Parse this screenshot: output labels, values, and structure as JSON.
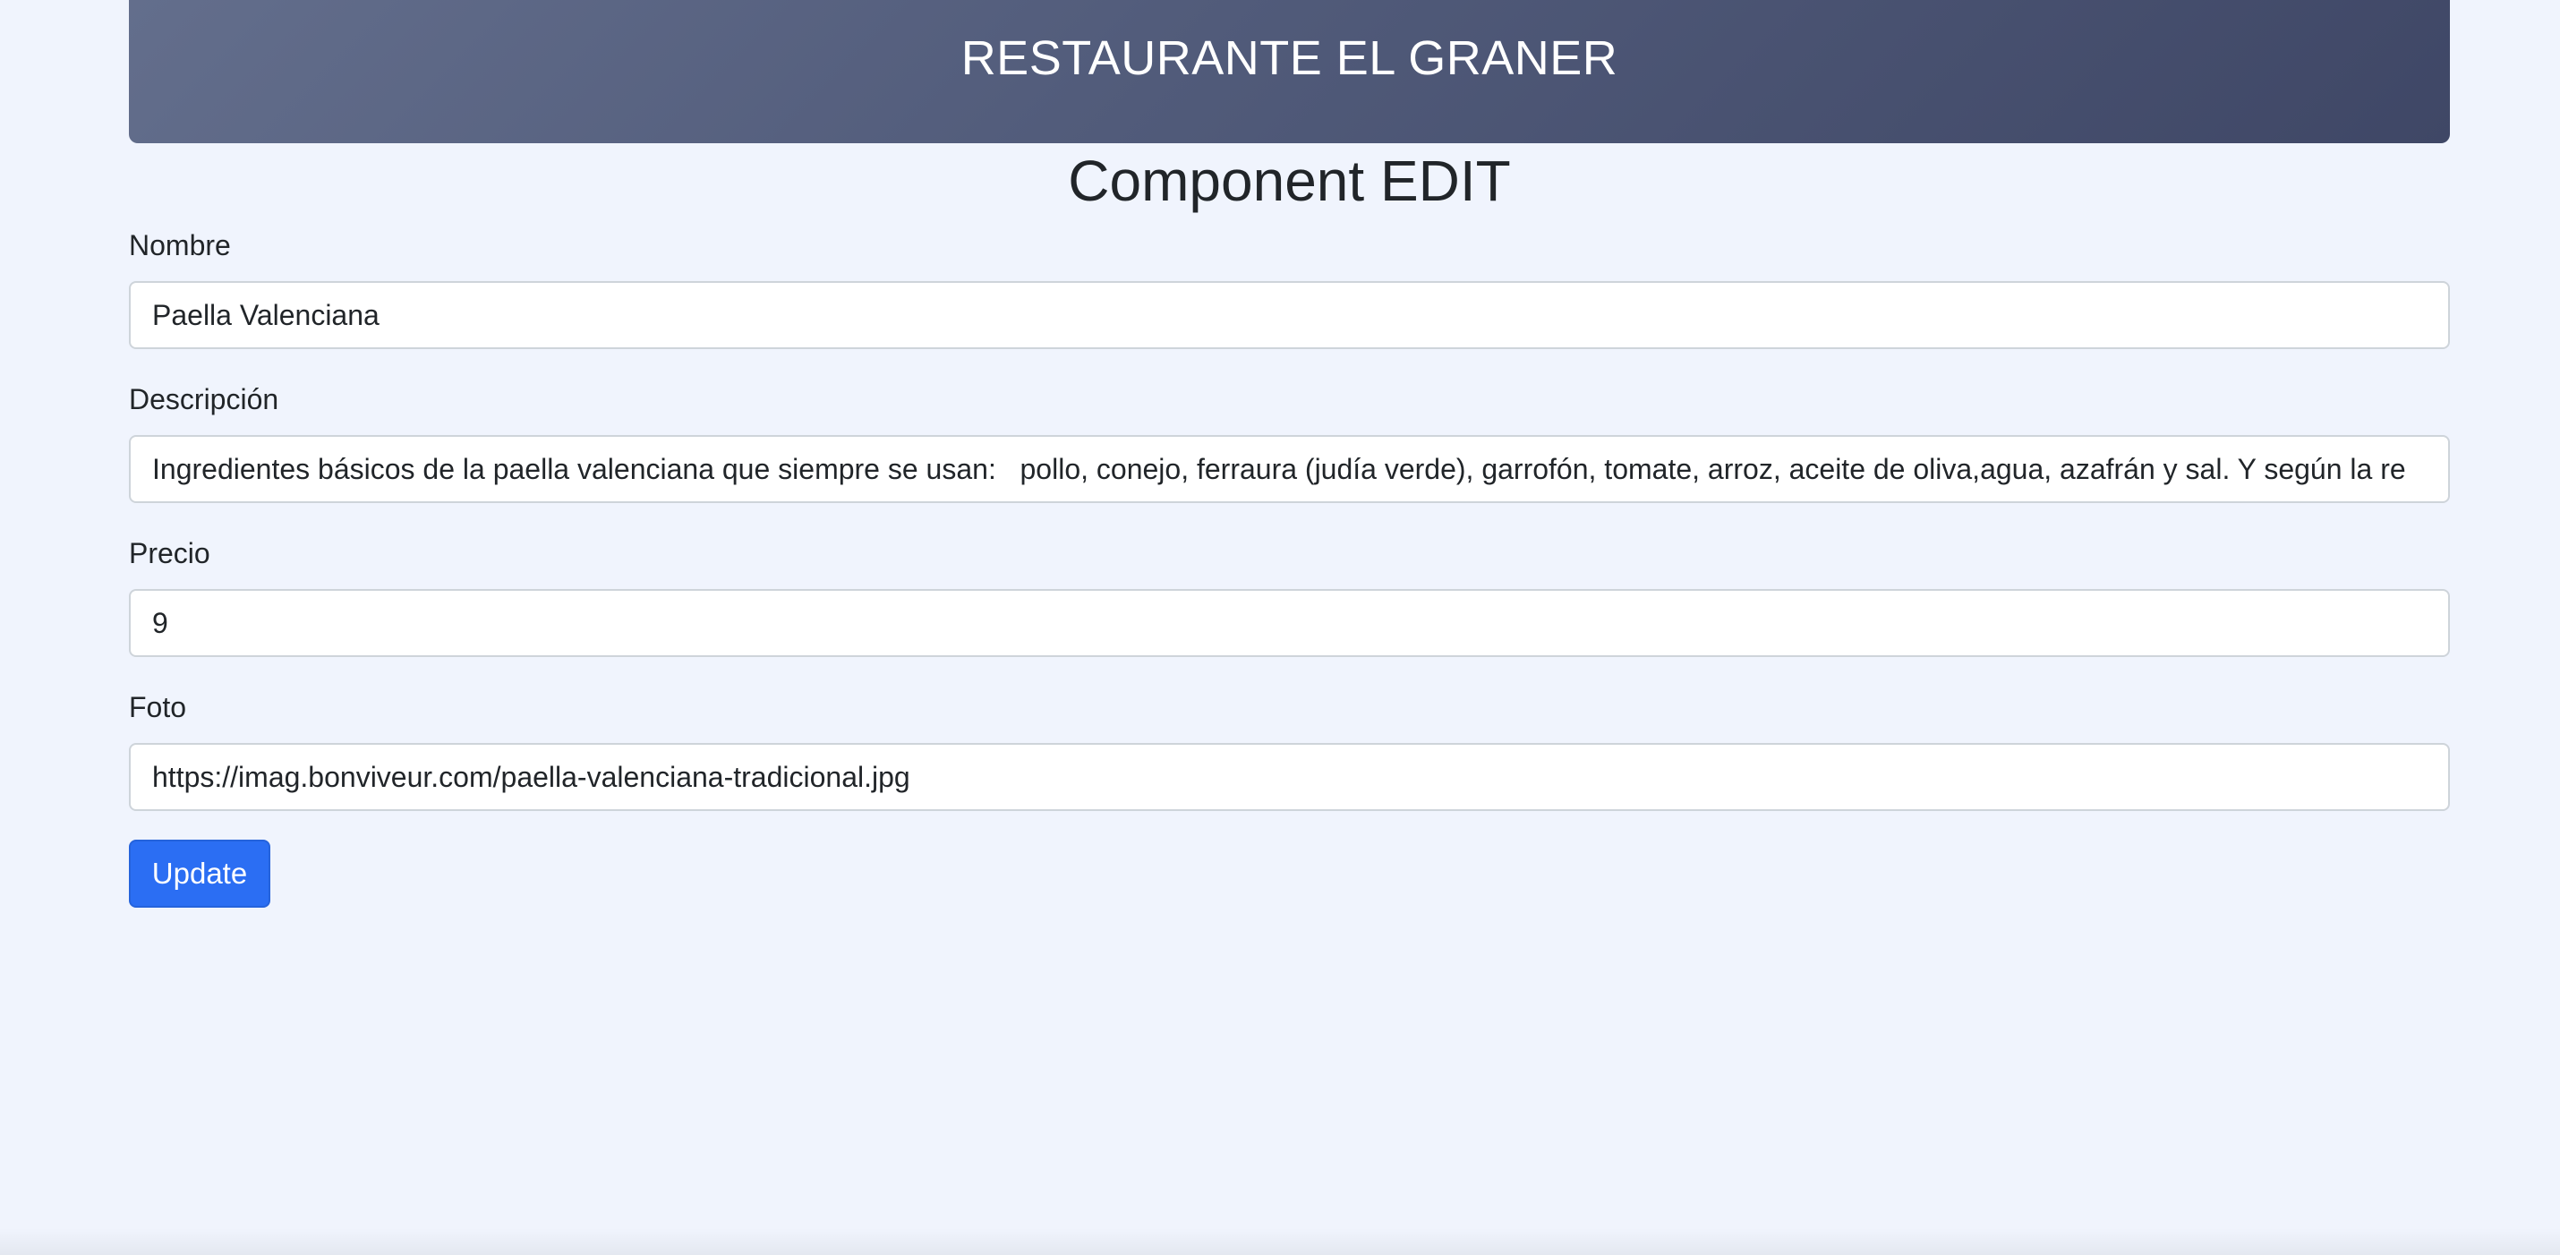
{
  "header": {
    "title": "RESTAURANTE EL GRANER"
  },
  "page": {
    "title": "Component EDIT"
  },
  "form": {
    "nombre": {
      "label": "Nombre",
      "value": "Paella Valenciana"
    },
    "descripcion": {
      "label": "Descripción",
      "value": "Ingredientes básicos de la paella valenciana que siempre se usan:   pollo, conejo, ferraura (judía verde), garrofón, tomate, arroz, aceite de oliva,agua, azafrán y sal. Y según la re"
    },
    "precio": {
      "label": "Precio",
      "value": "9"
    },
    "foto": {
      "label": "Foto",
      "value": "https://imag.bonviveur.com/paella-valenciana-tradicional.jpg"
    },
    "submit_label": "Update"
  },
  "colors": {
    "background": "#f0f4fd",
    "header_start": "#636e8c",
    "header_end": "#3f4766",
    "button": "#2b6ef3"
  }
}
